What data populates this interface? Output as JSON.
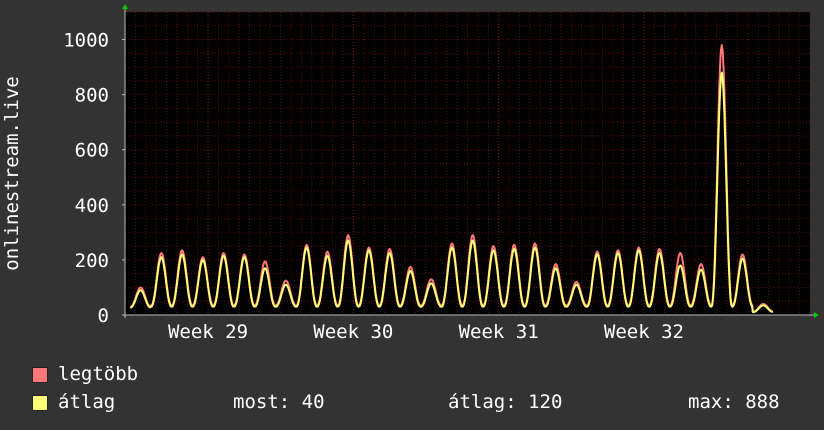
{
  "chart_data": {
    "type": "line",
    "ylabel": "onlinestream.live",
    "ylim": [
      0,
      1100
    ],
    "yticks": [
      0,
      200,
      400,
      600,
      800,
      1000
    ],
    "x_range": [
      0,
      33
    ],
    "x_ticks": [
      {
        "label": "Week 29",
        "value": 4
      },
      {
        "label": "Week 30",
        "value": 11
      },
      {
        "label": "Week 31",
        "value": 18
      },
      {
        "label": "Week 32",
        "value": 25
      }
    ],
    "grid": true,
    "colors": {
      "background": "#333333",
      "plot_bg": "#000000",
      "grid": "#5a0a0a",
      "axis": "#bbbbbb"
    },
    "series": [
      {
        "name": "legtöbb",
        "color": "#ff7777",
        "daily_peaks": [
          100,
          225,
          235,
          210,
          225,
          220,
          195,
          125,
          255,
          230,
          290,
          245,
          240,
          175,
          130,
          260,
          290,
          250,
          255,
          260,
          185,
          120,
          230,
          235,
          245,
          240,
          225,
          185,
          980,
          220,
          40
        ]
      },
      {
        "name": "átlag",
        "color": "#ffff77",
        "daily_peaks": [
          90,
          210,
          220,
          200,
          215,
          210,
          170,
          110,
          245,
          215,
          270,
          235,
          225,
          160,
          115,
          245,
          270,
          235,
          240,
          245,
          170,
          110,
          220,
          225,
          235,
          225,
          180,
          165,
          880,
          205,
          35
        ]
      }
    ]
  },
  "legend": {
    "max_label": "legtöbb",
    "avg_label": "átlag",
    "current_text": "most: 40",
    "average_text": "átlag: 120",
    "maximum_text": "max: 888"
  }
}
